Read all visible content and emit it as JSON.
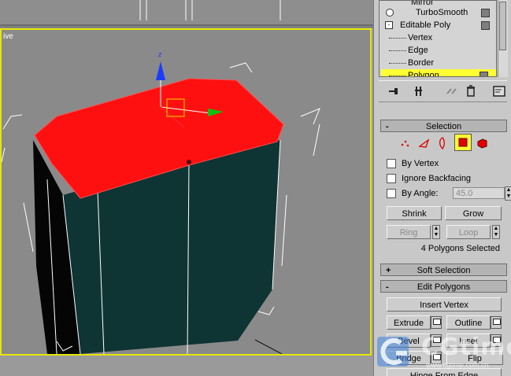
{
  "viewport": {
    "label": "ive"
  },
  "modifier_stack": {
    "items": [
      {
        "label": "Mirror",
        "kind": "modifier"
      },
      {
        "label": "TurboSmooth",
        "kind": "modifier"
      },
      {
        "label": "Editable Poly",
        "kind": "base"
      },
      {
        "label": "Vertex",
        "kind": "sub"
      },
      {
        "label": "Edge",
        "kind": "sub"
      },
      {
        "label": "Border",
        "kind": "sub"
      },
      {
        "label": "Polygon",
        "kind": "sub",
        "selected": true
      }
    ]
  },
  "stack_tools": [
    "pin-stack-icon",
    "show-end-result-icon",
    "make-unique-icon",
    "remove-modifier-icon",
    "configure-modifier-sets-icon"
  ],
  "selection": {
    "header": "Selection",
    "header_sign": "-",
    "subobject_icons": [
      "vertex-icon",
      "edge-icon",
      "border-icon",
      "polygon-icon",
      "element-icon"
    ],
    "active_subobject": "polygon-icon",
    "by_vertex": "By Vertex",
    "ignore_backfacing": "Ignore Backfacing",
    "by_angle": "By Angle:",
    "angle_value": "45.0",
    "shrink": "Shrink",
    "grow": "Grow",
    "ring": "Ring",
    "loop": "Loop",
    "status": "4 Polygons Selected"
  },
  "soft_selection": {
    "header": "Soft Selection",
    "header_sign": "+"
  },
  "edit_polygons": {
    "header": "Edit Polygons",
    "header_sign": "-",
    "insert_vertex": "Insert Vertex",
    "extrude": "Extrude",
    "outline": "Outline",
    "bevel": "Bevel",
    "inset": "Inset",
    "bridge": "Bridge",
    "flip": "Flip",
    "hinge_from_edge": "Hinge From Edge"
  },
  "watermark": {
    "text": "CGtime",
    "url": "www.cgtime.com.cn"
  },
  "colors": {
    "viewport_border": "#e6e600",
    "selected_face": "#ff1010",
    "mesh_body": "#0f3434",
    "selected_stack_item": "#ffff33",
    "gizmo_z": "#1a3cff",
    "gizmo_x": "#ff2020",
    "gizmo_y": "#10c010"
  }
}
